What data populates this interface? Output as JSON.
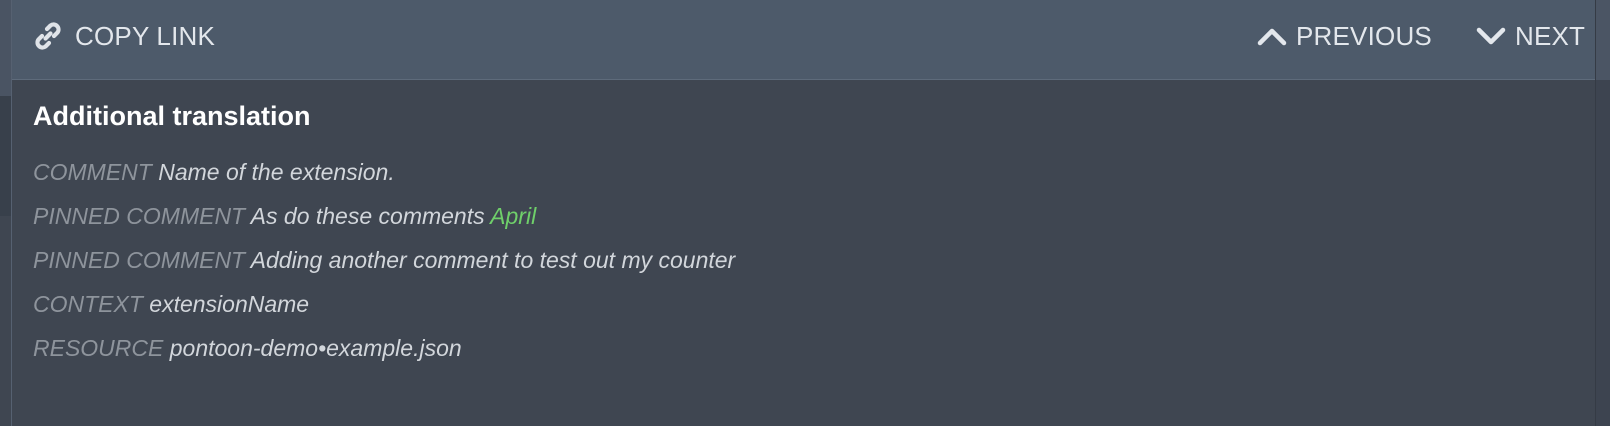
{
  "toolbar": {
    "copy_link_label": "COPY LINK",
    "previous_label": "PREVIOUS",
    "next_label": "NEXT",
    "icons": [
      "link-icon",
      "chevron-up-icon",
      "chevron-down-icon"
    ]
  },
  "entity": {
    "title": "Additional translation",
    "rows": [
      {
        "label": "COMMENT",
        "value": "Name of the extension."
      },
      {
        "label": "PINNED COMMENT",
        "value": "As do these comments",
        "mention": "April"
      },
      {
        "label": "PINNED COMMENT",
        "value": "Adding another comment to test out my counter"
      },
      {
        "label": "CONTEXT",
        "value": "extensionName"
      },
      {
        "label": "RESOURCE",
        "value": "pontoon-demo•example.json"
      }
    ]
  },
  "colors": {
    "toolbar_bg": "#4d5a6a",
    "panel_bg": "#3f4651",
    "label_gray": "#8e949c",
    "value_text": "#d2d6db",
    "mention_green": "#6fcf6a",
    "title_white": "#ffffff"
  }
}
